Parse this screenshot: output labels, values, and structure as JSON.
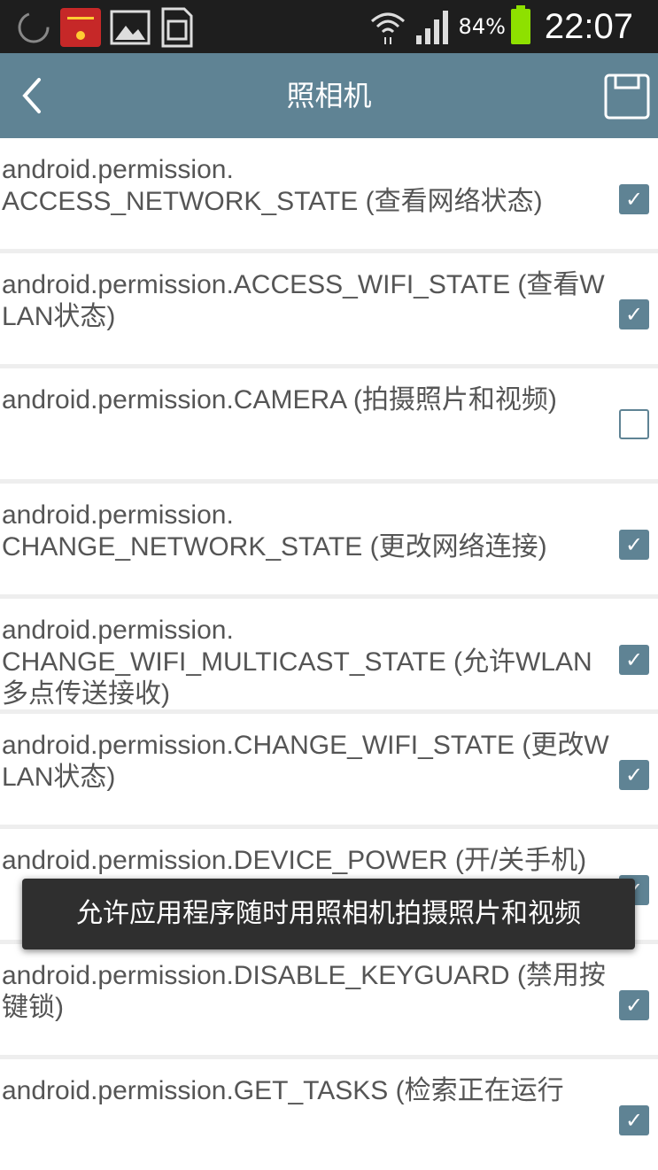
{
  "status_bar": {
    "battery_percent": "84%",
    "time": "22:07",
    "icons": [
      "sync-icon",
      "app-notification-icon",
      "image-icon",
      "sim-card-icon",
      "wifi-icon",
      "signal-icon",
      "battery-icon"
    ],
    "battery_color": "#8ee000"
  },
  "action_bar": {
    "title": "照相机",
    "back_icon": "back-arrow-icon",
    "save_icon": "save-icon",
    "color": "#5f8394"
  },
  "permissions": [
    {
      "label": "android.permission.\nACCESS_NETWORK_STATE (查看网络状态)",
      "checked": true
    },
    {
      "label": "android.permission.ACCESS_WIFI_STATE (查看WLAN状态)",
      "checked": true
    },
    {
      "label": "android.permission.CAMERA (拍摄照片和视频)",
      "checked": false
    },
    {
      "label": "android.permission.\nCHANGE_NETWORK_STATE (更改网络连接)",
      "checked": true
    },
    {
      "label": "android.permission.\nCHANGE_WIFI_MULTICAST_STATE (允许WLAN多点传送接收)",
      "checked": true
    },
    {
      "label": "android.permission.CHANGE_WIFI_STATE (更改WLAN状态)",
      "checked": true
    },
    {
      "label": "android.permission.DEVICE_POWER (开/关手机)",
      "checked": true
    },
    {
      "label": "android.permission.DISABLE_KEYGUARD (禁用按键锁)",
      "checked": true
    },
    {
      "label": "android.permission.GET_TASKS (检索正在运行",
      "checked": true
    }
  ],
  "toast": {
    "message": "允许应用程序随时用照相机拍摄照片和视频"
  }
}
